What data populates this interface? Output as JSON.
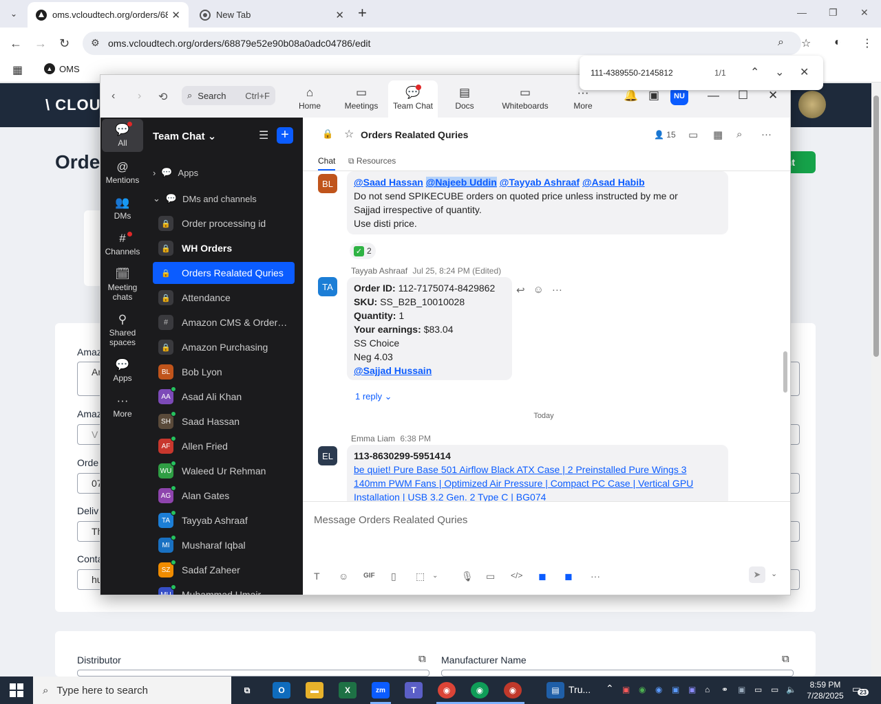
{
  "browser": {
    "tabs": [
      {
        "title": "oms.vcloudtech.org/orders/688",
        "active": true
      },
      {
        "title": "New Tab",
        "active": false
      }
    ],
    "url": "oms.vcloudtech.org/orders/68879e52e90b08a0adc04786/edit",
    "bookmark": "OMS",
    "find": {
      "query": "111-4389550-2145812",
      "count": "1/1"
    }
  },
  "oms": {
    "logo": "\\ CLOU",
    "title": "Orde",
    "green_button": "ent",
    "labels": [
      "Amaz",
      "Amaz",
      "Orde",
      "Deliv",
      "Conta"
    ],
    "inputs": [
      "An",
      "V",
      "07",
      "Th",
      "hu"
    ],
    "distributor_label": "Distributor",
    "manufacturer_label": "Manufacturer Name"
  },
  "zoom": {
    "search": {
      "label": "Search",
      "shortcut": "Ctrl+F"
    },
    "tabs": [
      {
        "label": "Home",
        "icon": "home-icon",
        "glyph": "⌂"
      },
      {
        "label": "Meetings",
        "icon": "video-icon",
        "glyph": "▭"
      },
      {
        "label": "Team Chat",
        "icon": "chat-icon",
        "glyph": "💬"
      },
      {
        "label": "Docs",
        "icon": "doc-icon",
        "glyph": "▤"
      },
      {
        "label": "Whiteboards",
        "icon": "whiteboard-icon",
        "glyph": "▭"
      },
      {
        "label": "More",
        "icon": "more-icon",
        "glyph": "···"
      }
    ],
    "user_initials": "NU",
    "rail": [
      {
        "label": "All",
        "icon": "chat-bubble-icon",
        "glyph": "💬"
      },
      {
        "label": "Mentions",
        "icon": "at-icon",
        "glyph": "@"
      },
      {
        "label": "DMs",
        "icon": "people-icon",
        "glyph": "👥"
      },
      {
        "label": "Channels",
        "icon": "hash-icon",
        "glyph": "#"
      },
      {
        "label": "Meeting chats",
        "icon": "calendar-chat-icon",
        "glyph": "🗓"
      },
      {
        "label": "Shared spaces",
        "icon": "shared-icon",
        "glyph": "⚲"
      },
      {
        "label": "Apps",
        "icon": "apps-icon",
        "glyph": "💬"
      },
      {
        "label": "More",
        "icon": "more-icon",
        "glyph": "···"
      }
    ],
    "sidebar": {
      "title": "Team Chat",
      "sections": [
        "Apps",
        "DMs and channels"
      ],
      "channels": [
        {
          "name": "Order processing id",
          "kind": "lock"
        },
        {
          "name": "WH Orders",
          "kind": "lock",
          "bold": true
        },
        {
          "name": "Orders Realated Quries",
          "kind": "lock",
          "active": true
        },
        {
          "name": "Attendance",
          "kind": "lock"
        },
        {
          "name": "Amazon CMS & OrderAu...",
          "kind": "hash"
        },
        {
          "name": "Amazon Purchasing",
          "kind": "lock"
        },
        {
          "name": "Bob Lyon",
          "kind": "dm",
          "initials": "BL",
          "color": "#c0541b",
          "online": false
        },
        {
          "name": "Asad Ali Khan",
          "kind": "dm",
          "initials": "AA",
          "color": "#7c4ab8",
          "online": true
        },
        {
          "name": "Saad Hassan",
          "kind": "dm",
          "initials": "SH",
          "color": "#5a4a3a",
          "online": true
        },
        {
          "name": "Allen Fried",
          "kind": "dm",
          "initials": "AF",
          "color": "#c8372d",
          "online": true
        },
        {
          "name": "Waleed Ur Rehman",
          "kind": "dm",
          "initials": "WU",
          "color": "#2f9e44",
          "online": true
        },
        {
          "name": "Alan Gates",
          "kind": "dm",
          "initials": "AG",
          "color": "#8e44ad",
          "online": true
        },
        {
          "name": "Tayyab Ashraaf",
          "kind": "dm",
          "initials": "TA",
          "color": "#1c7ed6",
          "online": true
        },
        {
          "name": "Musharaf Iqbal",
          "kind": "dm",
          "initials": "MI",
          "color": "#1971c2",
          "online": true
        },
        {
          "name": "Sadaf Zaheer",
          "kind": "dm",
          "initials": "SZ",
          "color": "#f08c00",
          "online": true
        },
        {
          "name": "Muhammad Umair",
          "kind": "dm",
          "initials": "MU",
          "color": "#364fc7",
          "online": true
        }
      ]
    },
    "chat": {
      "channel_name": "Orders Realated Quries",
      "member_count": "15",
      "tabs": [
        "Chat",
        "Resources"
      ],
      "msg1": {
        "initials": "BL",
        "mentions": [
          "@Saad Hassan",
          "@Najeeb Uddin",
          "@Tayyab Ashraaf",
          "@Asad Habib"
        ],
        "lines": [
          "Do not send SPIKECUBE orders on quoted price unless instructed by me or",
          "Sajjad irrespective of quantity.",
          "Use disti price."
        ],
        "reaction_count": "2"
      },
      "msg2": {
        "initials": "TA",
        "sender": "Tayyab Ashraaf",
        "time": "Jul 25, 8:24 PM (Edited)",
        "order_id_label": "Order ID:",
        "order_id": "112-7175074-8429862",
        "sku_label": "SKU:",
        "sku": "SS_B2B_10010028",
        "qty_label": "Quantity:",
        "qty": "1",
        "earn_label": "Your earnings:",
        "earn": "$83.04",
        "line5": "SS Choice",
        "line6": "Neg 4.03",
        "mention": "@Sajjad Hussain",
        "reply": "1 reply"
      },
      "divider": "Today",
      "msg3": {
        "initials": "EL",
        "sender": "Emma Liam",
        "time": "6:38 PM",
        "order": "113-8630299-5951414",
        "link": "be quiet! Pure Base 501 Airflow Black ATX Case | 2 Preinstalled Pure Wings 3 140mm PWM Fans | Optimized Air Pressure | Compact PC Case | Vertical GPU Installation | USB 3.2 Gen. 2 Type C | BG074"
      },
      "composer_placeholder": "Message Orders Realated Quries"
    }
  },
  "taskbar": {
    "search": "Type here to search",
    "truncated_app": "Tru...",
    "time": "8:59 PM",
    "date": "7/28/2025",
    "notifications": "23"
  },
  "colors": {
    "zoom_blue": "#0b5cff",
    "sidebar_bg": "#1b1b1d",
    "oms_header": "#1e2a3b"
  }
}
